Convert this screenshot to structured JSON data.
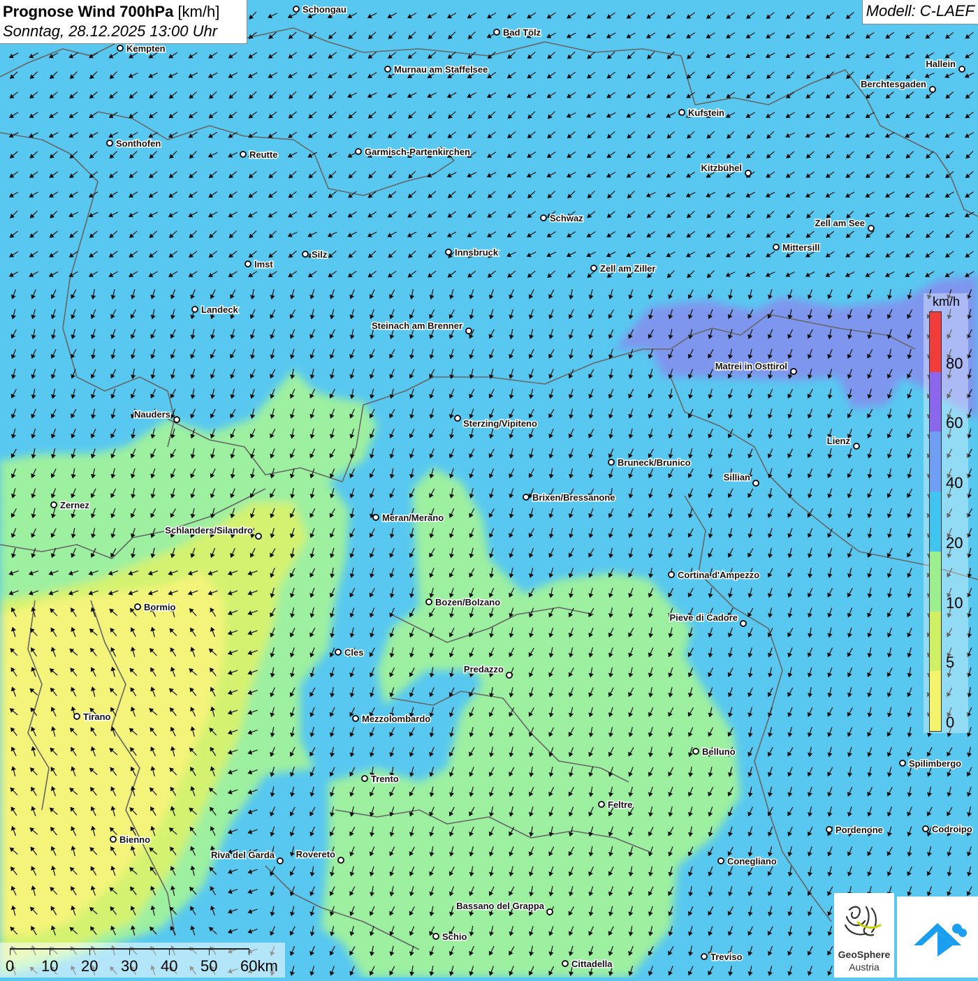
{
  "header": {
    "title_bold": "Prognose Wind 700hPa",
    "title_unit": "[km/h]",
    "date": "Sonntag, 28.12.2025 13:00 Uhr",
    "model": "Modell: C-LAEF"
  },
  "legend": {
    "unit": "km/h",
    "classes": [
      {
        "min": 0,
        "max": 5,
        "color": "#f4f46c"
      },
      {
        "min": 5,
        "max": 10,
        "color": "#cff065"
      },
      {
        "min": 10,
        "max": 20,
        "color": "#9bef8f"
      },
      {
        "min": 20,
        "max": 40,
        "color": "#40c4f0"
      },
      {
        "min": 40,
        "max": 60,
        "color": "#6f9ef5"
      },
      {
        "min": 60,
        "max": 80,
        "color": "#8b67ee"
      },
      {
        "min": 80,
        "max": 100,
        "color": "#f23b3b"
      }
    ],
    "labels": [
      "0",
      "5",
      "10",
      "20",
      "40",
      "60",
      "80"
    ]
  },
  "scale": {
    "labels": [
      "0",
      "10",
      "20",
      "30",
      "40",
      "50",
      "60km"
    ]
  },
  "logos": {
    "geosphere_name": "GeoSphere",
    "geosphere_sub": "Austria"
  },
  "cities": [
    {
      "name": "Schongau"
    },
    {
      "name": "Bad Tölz"
    },
    {
      "name": "Kempten"
    },
    {
      "name": "Murnau am Staffelsee"
    },
    {
      "name": "Hallein"
    },
    {
      "name": "Berchtesgaden"
    },
    {
      "name": "Kufstein"
    },
    {
      "name": "Sonthofen"
    },
    {
      "name": "Reutte"
    },
    {
      "name": "Garmisch-Partenkirchen"
    },
    {
      "name": "Kitzbühel"
    },
    {
      "name": "Schwaz"
    },
    {
      "name": "Zell am See"
    },
    {
      "name": "Mittersill"
    },
    {
      "name": "Silz"
    },
    {
      "name": "Innsbruck"
    },
    {
      "name": "Imst"
    },
    {
      "name": "Zell am Ziller"
    },
    {
      "name": "Landeck"
    },
    {
      "name": "Steinach am Brenner"
    },
    {
      "name": "Matrei in Osttirol"
    },
    {
      "name": "Nauders"
    },
    {
      "name": "Sterzing/Vipiteno"
    },
    {
      "name": "Lienz"
    },
    {
      "name": "Bruneck/Brunico"
    },
    {
      "name": "Sillian"
    },
    {
      "name": "Zernez"
    },
    {
      "name": "Brixen/Bressanone"
    },
    {
      "name": "Meran/Merano"
    },
    {
      "name": "Schlanders/Silandro"
    },
    {
      "name": "Cortina d'Ampezzo"
    },
    {
      "name": "Bozen/Bolzano"
    },
    {
      "name": "Bormio"
    },
    {
      "name": "Pieve di Cadore"
    },
    {
      "name": "Cles"
    },
    {
      "name": "Predazzo"
    },
    {
      "name": "Tirano"
    },
    {
      "name": "Mezzolombardo"
    },
    {
      "name": "Belluno"
    },
    {
      "name": "Spilimbergo"
    },
    {
      "name": "Trento"
    },
    {
      "name": "Feltre"
    },
    {
      "name": "Pordenone"
    },
    {
      "name": "Codroipo"
    },
    {
      "name": "Bienno"
    },
    {
      "name": "Riva del Garda"
    },
    {
      "name": "Rovereto"
    },
    {
      "name": "Conegliano"
    },
    {
      "name": "Bassano del Grappa"
    },
    {
      "name": "Schio"
    },
    {
      "name": "Treviso"
    },
    {
      "name": "Cittadella"
    }
  ]
}
